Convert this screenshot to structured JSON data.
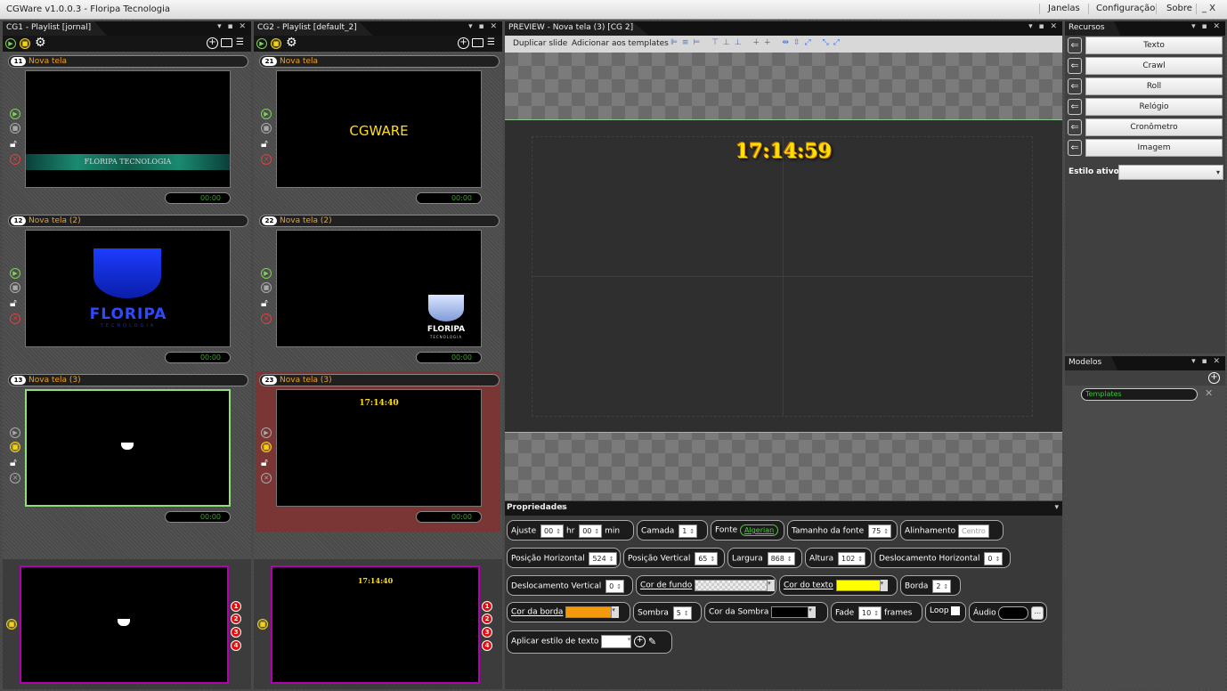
{
  "app": {
    "title": "CGWare v1.0.0.3 - Floripa Tecnologia",
    "menu": [
      "Janelas",
      "Configuração",
      "Sobre"
    ],
    "win_controls": "_ X"
  },
  "cg1": {
    "tab": "CG1 - Playlist  [jornal]",
    "slides": [
      {
        "num": "11",
        "name": "Nova tela",
        "timer": "00:00",
        "content": "FLORIPA TECNOLOGIA"
      },
      {
        "num": "12",
        "name": "Nova tela (2)",
        "timer": "00:00",
        "logo_text": "FLORIPA",
        "logo_sub": "TECNOLOGIA"
      },
      {
        "num": "13",
        "name": "Nova tela (3)",
        "timer": "00:00"
      }
    ],
    "outputs": [
      "1",
      "2",
      "3",
      "4"
    ]
  },
  "cg2": {
    "tab": "CG2 - Playlist  [default_2]",
    "slides": [
      {
        "num": "21",
        "name": "Nova tela",
        "timer": "00:00",
        "content": "CGWARE"
      },
      {
        "num": "22",
        "name": "Nova tela (2)",
        "timer": "00:00",
        "logo_text": "FLORIPA",
        "logo_sub": "TECNOLOGIA"
      },
      {
        "num": "23",
        "name": "Nova tela (3)",
        "timer": "00:00",
        "content": "17:14:40"
      }
    ],
    "outputs": [
      "1",
      "2",
      "3",
      "4"
    ],
    "live_clock": "17:14:40"
  },
  "preview": {
    "tab": "PREVIEW - Nova tela (3)  [CG 2]",
    "toolbar": {
      "duplicate": "Duplicar slide",
      "add_template": "Adicionar aos templates"
    },
    "clock": "17:14:59"
  },
  "properties": {
    "tab": "Propriedades",
    "ajuste_label": "Ajuste",
    "ajuste_hr": "00",
    "hr_label": "hr",
    "ajuste_min": "00",
    "min_label": "min",
    "camada_label": "Camada",
    "camada": "1",
    "fonte_label": "Fonte",
    "fonte_btn": "Algerian",
    "tam_label": "Tamanho da fonte",
    "tam": "75",
    "align_label": "Alinhamento",
    "align": "Centro",
    "posh_label": "Posição Horizontal",
    "posh": "524",
    "posv_label": "Posição Vertical",
    "posv": "65",
    "larg_label": "Largura",
    "larg": "868",
    "alt_label": "Altura",
    "alt": "102",
    "desh_label": "Deslocamento Horizontal",
    "desh": "0",
    "desv_label": "Deslocamento Vertical",
    "desv": "0",
    "cor_fundo_label": "Cor de fundo",
    "cor_texto_label": "Cor do texto",
    "cor_texto": "#ffff00",
    "borda_label": "Borda",
    "borda": "2",
    "cor_borda_label": "Cor da borda",
    "cor_borda": "#f59a0c",
    "sombra_label": "Sombra",
    "sombra": "5",
    "cor_sombra_label": "Cor da Sombra",
    "cor_sombra": "#000000",
    "fade_label": "Fade",
    "fade": "10",
    "frames_label": "frames",
    "loop_label": "Loop",
    "audio_label": "Áudio",
    "audio_btn": "...",
    "estilo_label": "Aplicar estilo de texto"
  },
  "recursos": {
    "tab": "Recursos",
    "buttons": [
      "Texto",
      "Crawl",
      "Roll",
      "Relógio",
      "Cronômetro",
      "Imagem"
    ],
    "estilo_label": "Estilo ativo:"
  },
  "modelos": {
    "tab": "Modelos",
    "search": "Templates"
  },
  "colors": {
    "accent_green": "#7fd35a",
    "accent_yellow": "#f2d21b",
    "playing_border": "#b200b2",
    "active_bg": "#7a3535"
  }
}
